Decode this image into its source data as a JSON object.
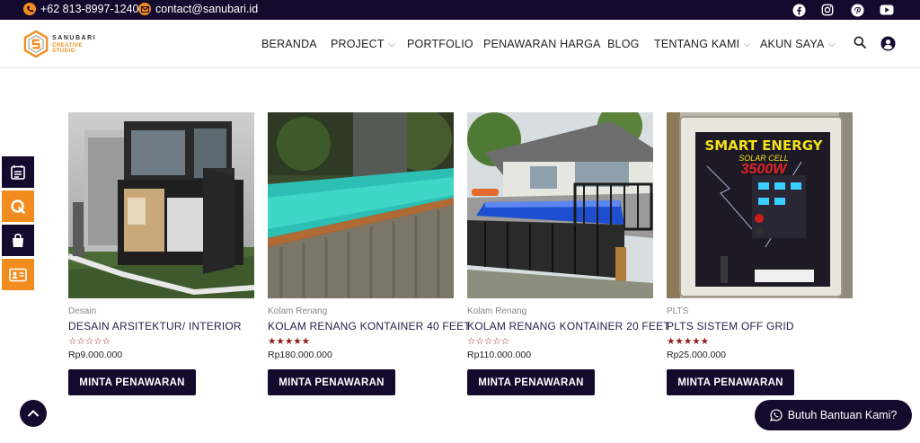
{
  "topbar": {
    "phone": "+62 813-8997-1240",
    "email": "contact@sanubari.id",
    "phone_icon": "phone-icon",
    "email_icon": "email-icon",
    "social": [
      "facebook-icon",
      "instagram-icon",
      "pinterest-icon",
      "youtube-icon"
    ]
  },
  "logo": {
    "line1": "SANUBARI",
    "line2": "CREATIVE STUDIO"
  },
  "nav": {
    "items": [
      {
        "label": "BERANDA"
      },
      {
        "label": "PROJECT"
      },
      {
        "label": "PORTFOLIO"
      },
      {
        "label": "PENAWARAN HARGA"
      },
      {
        "label": "BLOG"
      },
      {
        "label": "TENTANG KAMI"
      },
      {
        "label": "AKUN SAYA"
      }
    ]
  },
  "dock": [
    "catalog-icon",
    "quote-icon",
    "shopping-bag-icon",
    "contact-card-icon"
  ],
  "products": [
    {
      "category": "Desain",
      "title": "DESAIN ARSITEKTUR/ INTERIOR",
      "rating": 0,
      "stars": "☆☆☆☆☆",
      "price": "Rp9.000.000",
      "button": "MINTA PENAWARAN"
    },
    {
      "category": "Kolam Renang",
      "title": "KOLAM RENANG KONTAINER 40 FEET",
      "rating": 5,
      "stars": "★★★★★",
      "price": "Rp180.000.000",
      "button": "MINTA PENAWARAN"
    },
    {
      "category": "Kolam Renang",
      "title": "KOLAM RENANG KONTAINER 20 FEET",
      "rating": 0,
      "stars": "☆☆☆☆☆",
      "price": "Rp110.000.000",
      "button": "MINTA PENAWARAN"
    },
    {
      "category": "PLTS",
      "title": "PLTS SISTEM OFF GRID",
      "rating": 5,
      "stars": "★★★★★",
      "price": "Rp25.000.000",
      "button": "MINTA PENAWARAN"
    }
  ],
  "panel_text": {
    "brand": "SMART ENERGY",
    "sub": "SOLAR CELL",
    "watt": "3500W"
  },
  "whatsapp": {
    "label": "Butuh Bantuan Kami?"
  },
  "colors": {
    "primary": "#140a2e",
    "accent": "#f28c1e",
    "star": "#8b1a1a"
  }
}
